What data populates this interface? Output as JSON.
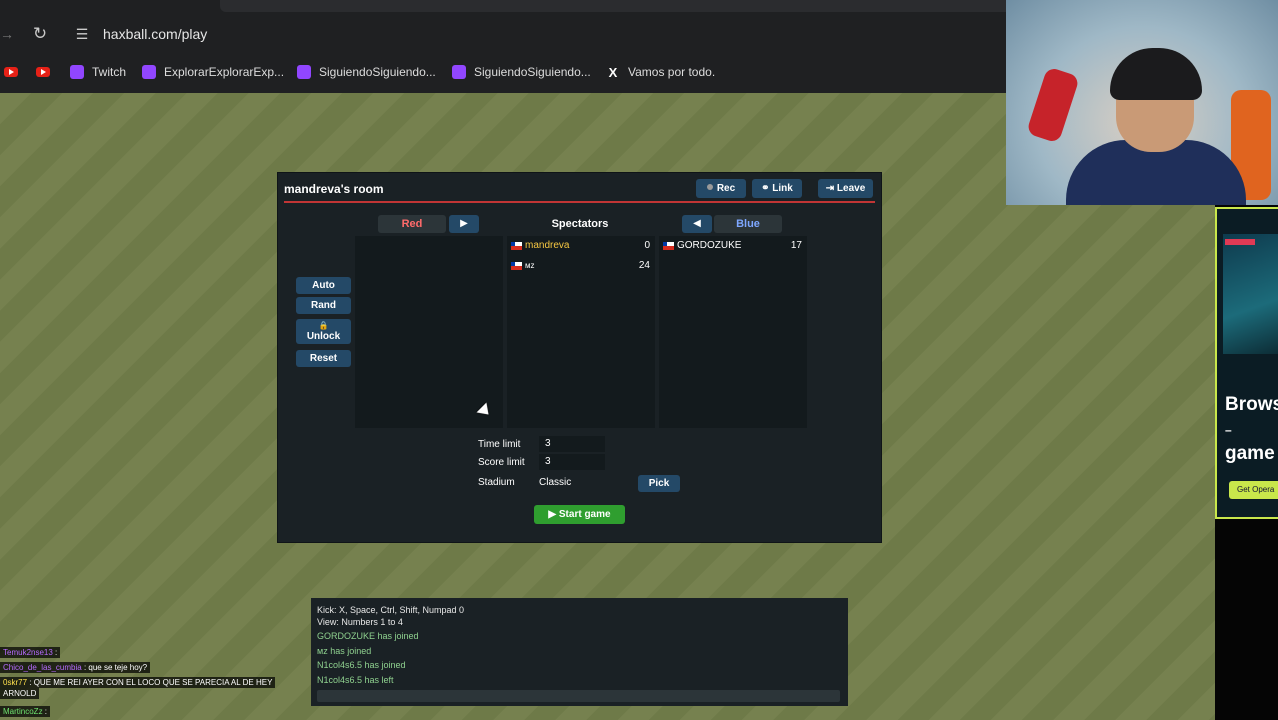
{
  "browser": {
    "url": "haxball.com/play",
    "bookmarks": [
      {
        "icon": "youtube-icon",
        "label": ""
      },
      {
        "icon": "youtube-icon",
        "label": ""
      },
      {
        "icon": "twitch-icon",
        "label": "Twitch"
      },
      {
        "icon": "twitch-icon",
        "label": "ExplorarExplorarExp..."
      },
      {
        "icon": "twitch-icon",
        "label": "SiguiendoSiguiendo..."
      },
      {
        "icon": "twitch-icon",
        "label": "SiguiendoSiguiendo..."
      },
      {
        "icon": "x-icon",
        "label": "Vamos por todo."
      }
    ]
  },
  "room": {
    "title": "mandreva's room",
    "buttons": {
      "rec": "Rec",
      "link": "Link",
      "leave": "Leave"
    },
    "teams": {
      "red": "Red",
      "spectators": "Spectators",
      "blue": "Blue"
    },
    "side_buttons": {
      "auto": "Auto",
      "rand": "Rand",
      "unlock": "Unlock",
      "reset": "Reset"
    },
    "spectators": [
      {
        "name": "mandreva",
        "score": "0"
      },
      {
        "name": "мz",
        "score": "24"
      }
    ],
    "blue_players": [
      {
        "name": "GORDOZUKE",
        "score": "17"
      }
    ],
    "settings": {
      "time_limit_label": "Time limit",
      "time_limit": "3",
      "score_limit_label": "Score limit",
      "score_limit": "3",
      "stadium_label": "Stadium",
      "stadium": "Classic",
      "pick": "Pick"
    },
    "start_game": "Start game"
  },
  "chat": {
    "lines": [
      {
        "type": "sys",
        "text": "Kick: X, Space, Ctrl, Shift, Numpad 0"
      },
      {
        "type": "sys",
        "text": "View: Numbers 1 to 4"
      },
      {
        "type": "join",
        "text": "GORDOZUKE has joined"
      },
      {
        "type": "join",
        "text": "мz has joined"
      },
      {
        "type": "join",
        "text": "N1col4s6.5 has joined"
      },
      {
        "type": "join",
        "text": "N1col4s6.5 has left"
      }
    ]
  },
  "stream_chat": [
    {
      "user": "Temuk2nse13",
      "msg": ""
    },
    {
      "user": "Chico_de_las_cumbia",
      "msg": "que se teje hoy?"
    },
    {
      "user": "0skr77",
      "msg": "QUE ME REI AYER CON EL LOCO QUE SE PARECIA AL DE HEY"
    },
    {
      "user": "",
      "msg": "ARNOLD"
    },
    {
      "user": "MartincoZz",
      "msg": ""
    }
  ],
  "ad": {
    "headline": "Brows",
    "headline2": "game",
    "cta": "Get Opera"
  }
}
